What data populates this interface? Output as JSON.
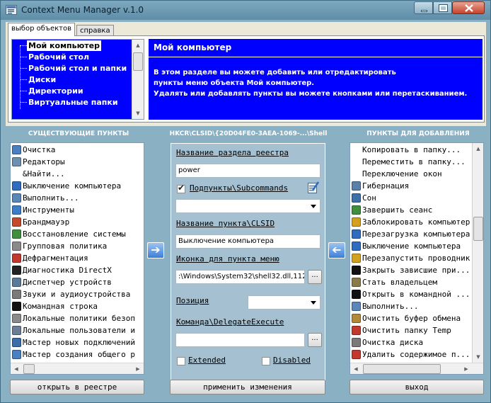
{
  "window": {
    "title": "Context Menu Manager  v.1.0"
  },
  "tabs": [
    {
      "label": "выбор объектов"
    },
    {
      "label": "справка"
    }
  ],
  "objects": [
    {
      "label": "Мой компьютер"
    },
    {
      "label": "Рабочий стол"
    },
    {
      "label": "Рабочий стол и папки"
    },
    {
      "label": "Диски"
    },
    {
      "label": "Директории"
    },
    {
      "label": "Виртуальные папки"
    }
  ],
  "description": {
    "title": "Мой компьютер",
    "lines": [
      "В этом разделе вы можете добавить или отредактировать",
      "пункты меню объекта Мой компьютер.",
      "Удалять или добавлять пункты вы можете кнопками или перетаскиванием."
    ]
  },
  "headers": {
    "existing": "СУЩЕСТВУЮЩИЕ ПУНКТЫ",
    "registry": "HKCR\\CLSID\\{20D04FE0-3AEA-1069-...\\Shell",
    "to_add": "ПУНКТЫ ДЛЯ ДОБАВЛЕНИЯ"
  },
  "existing_items": [
    {
      "label": "Очистка",
      "icon": "broom-icon",
      "color": "#4a7fc1"
    },
    {
      "label": "Редакторы",
      "icon": "notepad-icon",
      "color": "#6d8fb0"
    },
    {
      "label": "&Найти...",
      "icon": "",
      "color": ""
    },
    {
      "label": "Выключение компьютера",
      "icon": "power-icon",
      "color": "#2f6cc0"
    },
    {
      "label": "Выполнить...",
      "icon": "run-icon",
      "color": "#5a86b8"
    },
    {
      "label": "Инструменты",
      "icon": "tools-icon",
      "color": "#3d7cc9"
    },
    {
      "label": "Брандмауэр",
      "icon": "shield-icon",
      "color": "#c24a2f"
    },
    {
      "label": "Восстановление системы",
      "icon": "restore-icon",
      "color": "#3f8f3f"
    },
    {
      "label": "Групповая политика",
      "icon": "policy-icon",
      "color": "#8a8a8a"
    },
    {
      "label": "Дефрагментация",
      "icon": "defrag-icon",
      "color": "#c23a2f"
    },
    {
      "label": "Диагностика DirectX",
      "icon": "directx-icon",
      "color": "#222222"
    },
    {
      "label": "Диспетчер устройств",
      "icon": "devices-icon",
      "color": "#5b7a9a"
    },
    {
      "label": "Звуки и аудиоустройства",
      "icon": "speaker-icon",
      "color": "#7a7a7a"
    },
    {
      "label": "Командная строка",
      "icon": "cmd-icon",
      "color": "#111111"
    },
    {
      "label": "Локальные политики безоп",
      "icon": "policy-icon",
      "color": "#8a8a8a"
    },
    {
      "label": "Локальные пользователи и",
      "icon": "users-icon",
      "color": "#6a7f95"
    },
    {
      "label": "Мастер новых подключений",
      "icon": "network-icon",
      "color": "#3a6ea8"
    },
    {
      "label": "Мастер создания общего р",
      "icon": "share-icon",
      "color": "#4a7fc1"
    }
  ],
  "add_items": [
    {
      "label": "Копировать в папку...",
      "icon": "",
      "color": ""
    },
    {
      "label": "Переместить в папку...",
      "icon": "",
      "color": ""
    },
    {
      "label": "Переключение окон",
      "icon": "",
      "color": ""
    },
    {
      "label": "Гибернация",
      "icon": "hibernate-icon",
      "color": "#5a7fa8"
    },
    {
      "label": "Сон",
      "icon": "sleep-icon",
      "color": "#3d6fa8"
    },
    {
      "label": "Завершить сеанс",
      "icon": "logoff-icon",
      "color": "#3f8f3f"
    },
    {
      "label": "Заблокировать компьютер",
      "icon": "lock-icon",
      "color": "#d4a020"
    },
    {
      "label": "Перезагрузка компьютера",
      "icon": "restart-icon",
      "color": "#2f6cc0"
    },
    {
      "label": "Выключение компьютера",
      "icon": "power-icon",
      "color": "#2f6cc0"
    },
    {
      "label": "Перезапустить проводник",
      "icon": "explorer-icon",
      "color": "#d4a020"
    },
    {
      "label": "Закрыть зависшие при...",
      "icon": "cmd-icon",
      "color": "#111111"
    },
    {
      "label": "Стать владельцем",
      "icon": "key-icon",
      "color": "#8a7a4a"
    },
    {
      "label": "Открыть в командной ...",
      "icon": "cmd-icon",
      "color": "#111111"
    },
    {
      "label": "Выполнить...",
      "icon": "run-icon",
      "color": "#5a86b8"
    },
    {
      "label": "Очистить буфер обмена",
      "icon": "clipboard-icon",
      "color": "#b08a3a"
    },
    {
      "label": "Очистить папку Temp",
      "icon": "delete-icon",
      "color": "#c23a2f"
    },
    {
      "label": "Очистка диска",
      "icon": "disk-cleanup-icon",
      "color": "#7a7a7a"
    },
    {
      "label": "Удалить содержимое п...",
      "icon": "delete-icon",
      "color": "#c23a2f"
    }
  ],
  "form": {
    "registry_section_label": "Название раздела реестра",
    "registry_section_value": "power",
    "subcommands_label": "Подпункты\\Subcommands",
    "subcommands_checked": true,
    "item_name_label": "Название пункта\\CLSID",
    "item_name_value": "Выключение компьютера",
    "icon_label": "Иконка для пункта меню",
    "icon_value": ":\\Windows\\System32\\shell32.dll,112",
    "position_label": "Позиция",
    "command_label": "Команда\\DelegateExecute",
    "command_value": "",
    "extended_label": "Extended",
    "disabled_label": "Disabled",
    "browse_label": "..."
  },
  "buttons": {
    "open_registry": "открыть в реестре",
    "apply": "применить изменения",
    "exit": "выход"
  },
  "colors": {
    "accent_blue": "#0000ff",
    "panel": "#8ab0c4"
  }
}
